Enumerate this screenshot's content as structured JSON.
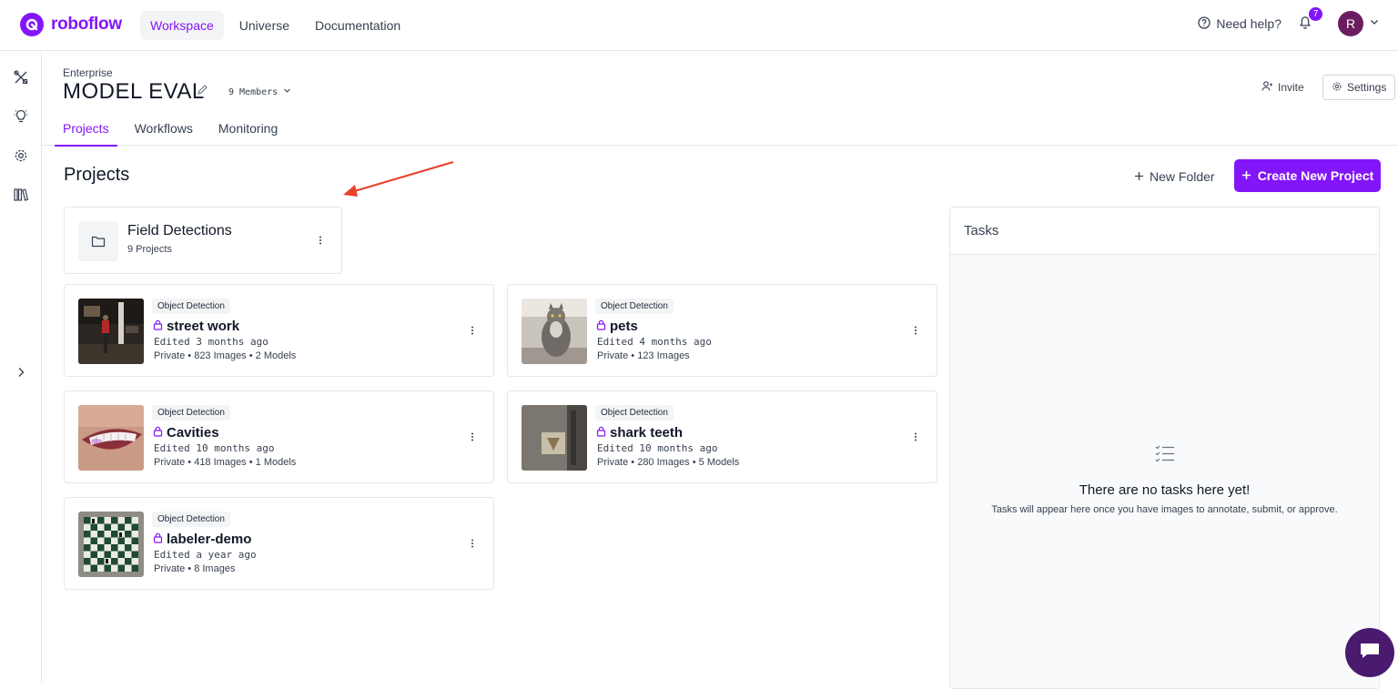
{
  "app": {
    "brand": "roboflow",
    "accent": "#8315f9"
  },
  "topnav": {
    "items": [
      {
        "label": "Workspace",
        "active": true
      },
      {
        "label": "Universe",
        "active": false
      },
      {
        "label": "Documentation",
        "active": false
      }
    ],
    "help_label": "Need help?",
    "notification_count": "7",
    "avatar_initial": "R"
  },
  "sidebar": {
    "icons": [
      "tools-icon",
      "lightbulb-icon",
      "gear-icon",
      "library-icon",
      "chevron-right-icon"
    ]
  },
  "workspace": {
    "plan": "Enterprise",
    "name": "MODEL EVAL",
    "members": "9 Members",
    "invite_label": "Invite",
    "settings_label": "Settings"
  },
  "tabs": [
    {
      "label": "Projects",
      "active": true
    },
    {
      "label": "Workflows",
      "active": false
    },
    {
      "label": "Monitoring",
      "active": false
    }
  ],
  "projects_section": {
    "title": "Projects",
    "new_folder_label": "New Folder",
    "create_label": "Create New Project"
  },
  "folder": {
    "name": "Field Detections",
    "count": "9 Projects"
  },
  "projects": [
    {
      "type": "Object Detection",
      "name": "street work",
      "edited": "Edited 3 months ago",
      "meta": "Private • 823 Images • 2 Models"
    },
    {
      "type": "Object Detection",
      "name": "pets",
      "edited": "Edited 4 months ago",
      "meta": "Private • 123 Images"
    },
    {
      "type": "Object Detection",
      "name": "Cavities",
      "edited": "Edited 10 months ago",
      "meta": "Private • 418 Images • 1 Models"
    },
    {
      "type": "Object Detection",
      "name": "shark teeth",
      "edited": "Edited 10 months ago",
      "meta": "Private • 280 Images • 5 Models"
    },
    {
      "type": "Object Detection",
      "name": "labeler-demo",
      "edited": "Edited a year ago",
      "meta": "Private • 8 Images"
    }
  ],
  "tasks": {
    "title": "Tasks",
    "empty_title": "There are no tasks here yet!",
    "empty_sub": "Tasks will appear here once you have images to annotate, submit, or approve."
  }
}
